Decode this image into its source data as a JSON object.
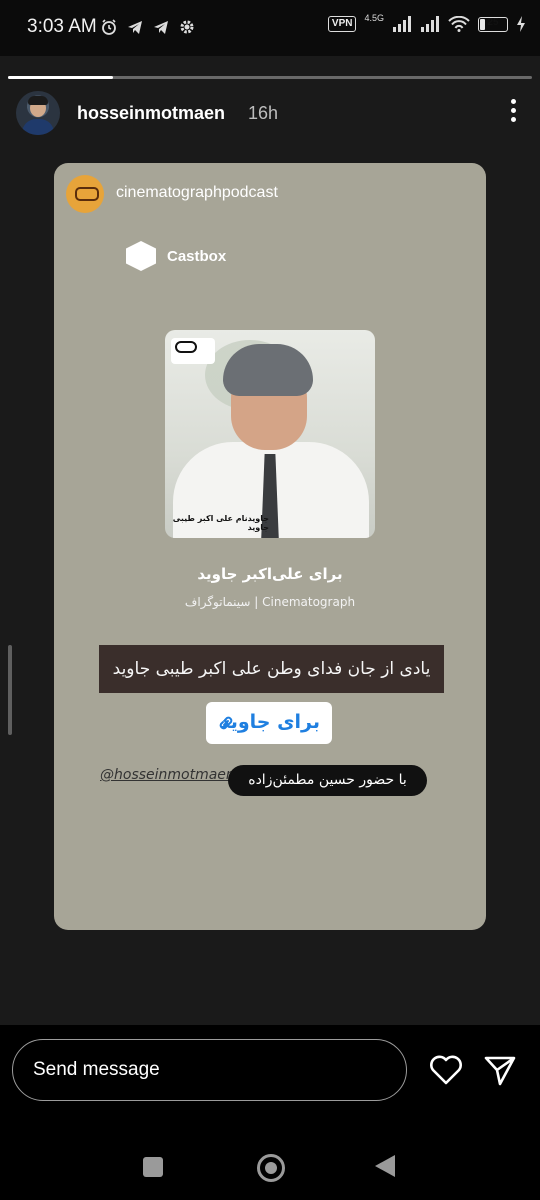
{
  "status_bar": {
    "time": "3:03 AM",
    "vpn": "VPN",
    "network": "4.5G",
    "battery_percent": "25",
    "battery_level": 0.25
  },
  "story": {
    "progress": 0.2,
    "username": "hosseinmotmaen",
    "age": "16h"
  },
  "shared_post": {
    "source_account": "cinematographpodcast",
    "platform": "Castbox",
    "cover_caption": "جاویدنام علی اکبر طیبی جاوید",
    "episode_title": "برای علی‌اکبر جاوید",
    "podcast_name": "سینماتوگراف | Cinematograph"
  },
  "stickers": {
    "text": "یادی از جان فدای وطن علی اکبر طیبی جاوید",
    "link": "برای جاوید",
    "mention": "@hosseinmotmaen",
    "chip": "با حضور حسین مطمئن‌زاده"
  },
  "reply": {
    "placeholder": "Send message"
  },
  "icons": {
    "like": "heart-icon",
    "share": "send-icon",
    "nav": [
      "recents-icon",
      "home-icon",
      "back-icon"
    ]
  }
}
